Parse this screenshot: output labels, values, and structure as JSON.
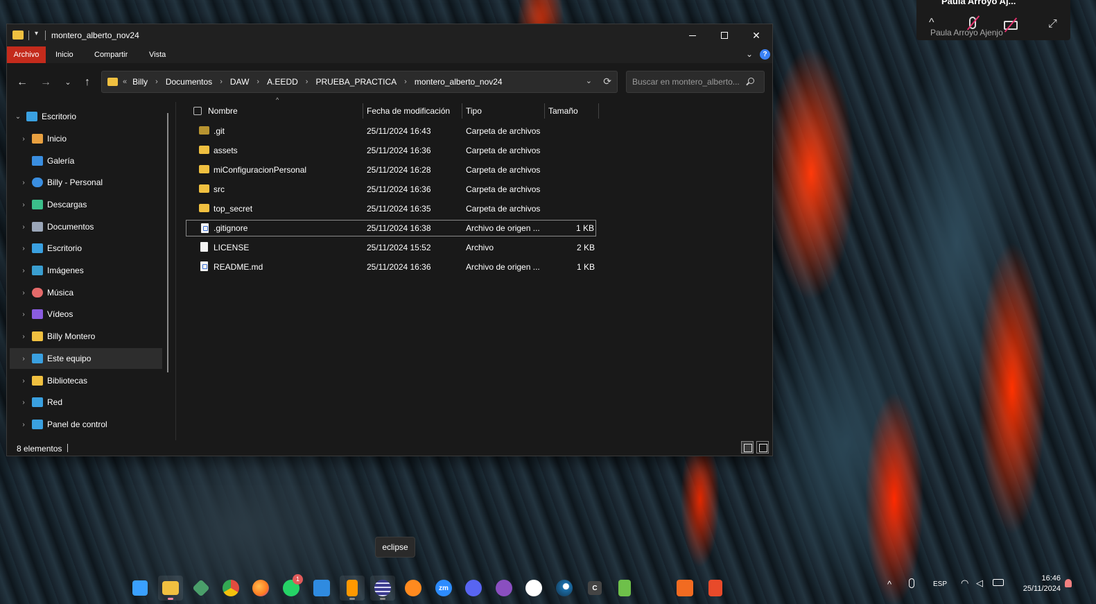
{
  "window": {
    "title": "montero_alberto_nov24",
    "quick_access": "▾",
    "controls": {
      "minimize": "",
      "maximize": "",
      "close": "✕"
    }
  },
  "ribbon": {
    "tabs": [
      "Archivo",
      "Inicio",
      "Compartir",
      "Vista"
    ],
    "collapse": "⌄",
    "help": "?"
  },
  "nav": {
    "back": "←",
    "forward": "→",
    "recent": "⌄",
    "up": "↑",
    "overflow": "«",
    "breadcrumbs": [
      "Billy",
      "Documentos",
      "DAW",
      "A.EEDD",
      "PRUEBA_PRACTICA",
      "montero_alberto_nov24"
    ],
    "dropdown": "⌄",
    "refresh": "⟳",
    "search_placeholder": "Buscar en montero_alberto..."
  },
  "sidebar": {
    "items": [
      {
        "label": "Escritorio",
        "icon": "desktop-icon",
        "color": "#3aa0e0",
        "chevron": "⌄"
      },
      {
        "label": "Inicio",
        "icon": "home-icon",
        "color": "#e8a040",
        "chevron": "›"
      },
      {
        "label": "Galería",
        "icon": "gallery-icon",
        "color": "#3a8ee0",
        "chevron": ""
      },
      {
        "label": "Billy - Personal",
        "icon": "onedrive-icon",
        "color": "#3a8ee0",
        "chevron": "›"
      },
      {
        "label": "Descargas",
        "icon": "downloads-icon",
        "color": "#3bbf8a",
        "chevron": "›"
      },
      {
        "label": "Documentos",
        "icon": "documents-icon",
        "color": "#9aa6b8",
        "chevron": "›"
      },
      {
        "label": "Escritorio",
        "icon": "desktop-icon",
        "color": "#3aa0e0",
        "chevron": "›"
      },
      {
        "label": "Imágenes",
        "icon": "pictures-icon",
        "color": "#3a9ed0",
        "chevron": "›"
      },
      {
        "label": "Música",
        "icon": "music-icon",
        "color": "#e56a6a",
        "chevron": "›"
      },
      {
        "label": "Vídeos",
        "icon": "videos-icon",
        "color": "#8a5ce0",
        "chevron": "›"
      },
      {
        "label": "Billy Montero",
        "icon": "folder-icon",
        "color": "#f0c040",
        "chevron": "›"
      },
      {
        "label": "Este equipo",
        "icon": "this-pc-icon",
        "color": "#3aa0e0",
        "chevron": "›"
      },
      {
        "label": "Bibliotecas",
        "icon": "libraries-icon",
        "color": "#f0c040",
        "chevron": "›"
      },
      {
        "label": "Red",
        "icon": "network-icon",
        "color": "#3aa0e0",
        "chevron": "›"
      },
      {
        "label": "Panel de control",
        "icon": "control-panel-icon",
        "color": "#3aa0e0",
        "chevron": "›"
      }
    ],
    "selected_index": 11
  },
  "list": {
    "sort_arrow": "^",
    "columns": [
      "Nombre",
      "Fecha de modificación",
      "Tipo",
      "Tamaño"
    ],
    "rows": [
      {
        "name": ".git",
        "date": "25/11/2024 16:43",
        "type": "Carpeta de archivos",
        "size": "",
        "icon": "git-folder-icon"
      },
      {
        "name": "assets",
        "date": "25/11/2024 16:36",
        "type": "Carpeta de archivos",
        "size": "",
        "icon": "folder-icon"
      },
      {
        "name": "miConfiguracionPersonal",
        "date": "25/11/2024 16:28",
        "type": "Carpeta de archivos",
        "size": "",
        "icon": "folder-icon"
      },
      {
        "name": "src",
        "date": "25/11/2024 16:36",
        "type": "Carpeta de archivos",
        "size": "",
        "icon": "folder-icon"
      },
      {
        "name": "top_secret",
        "date": "25/11/2024 16:35",
        "type": "Carpeta de archivos",
        "size": "",
        "icon": "folder-icon"
      },
      {
        "name": ".gitignore",
        "date": "25/11/2024 16:38",
        "type": "Archivo de origen ...",
        "size": "1 KB",
        "icon": "code-file-icon"
      },
      {
        "name": "LICENSE",
        "date": "25/11/2024 15:52",
        "type": "Archivo",
        "size": "2 KB",
        "icon": "file-icon"
      },
      {
        "name": "README.md",
        "date": "25/11/2024 16:36",
        "type": "Archivo de origen ...",
        "size": "1 KB",
        "icon": "code-file-icon"
      }
    ],
    "focused_index": 5
  },
  "status": {
    "count": "8 elementos"
  },
  "meeting": {
    "title": "Paula Arroyo Aj...",
    "participant": "Paula Arroyo Ajenjo",
    "caret": "^",
    "expand": "⤢"
  },
  "tooltip": "eclipse",
  "taskbar": {
    "apps": [
      {
        "name": "start",
        "color": "#3aa0ff"
      },
      {
        "name": "file-explorer",
        "color": "#f0c040"
      },
      {
        "name": "git",
        "color": "#4a9e6a"
      },
      {
        "name": "chrome",
        "color": "#e8a020"
      },
      {
        "name": "firefox",
        "color": "#ff7a20"
      },
      {
        "name": "whatsapp",
        "color": "#25d366"
      },
      {
        "name": "vscode",
        "color": "#2f8be0"
      },
      {
        "name": "sublime",
        "color": "#ff9800"
      },
      {
        "name": "eclipse",
        "color": "#3b3b8f"
      },
      {
        "name": "sourcetree",
        "color": "#ff8a1f"
      },
      {
        "name": "zoom",
        "color": "#2d8cff"
      },
      {
        "name": "discord",
        "color": "#5865f2"
      },
      {
        "name": "github-desktop",
        "color": "#8a4fc0"
      },
      {
        "name": "github",
        "color": "#ffffff"
      },
      {
        "name": "steam",
        "color": "#1b2838"
      },
      {
        "name": "c-app",
        "color": "#444444"
      },
      {
        "name": "notepad-plus",
        "color": "#6ec04a"
      },
      {
        "name": "xampp-app",
        "color": "#f26b21"
      },
      {
        "name": "xampp-control",
        "color": "#e84a2a"
      }
    ],
    "whatsapp_badge": "1",
    "zoom_label": "zm",
    "c_label": "C",
    "tray": {
      "lang": "ESP",
      "time": "16:46",
      "date": "25/11/2024"
    }
  }
}
